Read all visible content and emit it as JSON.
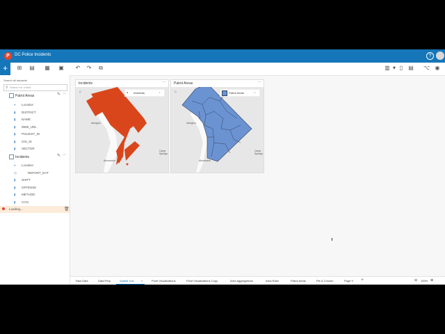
{
  "app": {
    "title": "DC Police Incidents",
    "logo_letter": "P"
  },
  "sidebar": {
    "search_placeholder": "Search all datasets",
    "search_small": "Search for a field",
    "datasets": [
      {
        "name": "Patrol Areas",
        "fields": [
          "Location",
          "DISTRICT",
          "NAME",
          "WEB_URL",
          "POLDIST_ID",
          "GIS_ID",
          "SECTOR"
        ]
      },
      {
        "name": "Incidents",
        "fields": [
          "Location",
          "REPORT_DAT",
          "SHIFT",
          "OFFENSE",
          "METHOD",
          "CCN"
        ]
      }
    ],
    "loading_text": "Loading..."
  },
  "cards": [
    {
      "title": "Incidents",
      "legend": "Incidents"
    },
    {
      "title": "Patrol Areas",
      "legend": "Patrol Areas"
    }
  ],
  "map_labels": {
    "arlington": "Arlington",
    "alexandria": "Alexandria",
    "camp_springs": "Camp Springs"
  },
  "tabs": [
    "Raw Data",
    "Data Prep",
    "Spatial Join",
    "Point Visualizations",
    "Point Visualizations Copy",
    "Area Aggregations",
    "Area Ratio",
    "Patrol Areas",
    "Pie & Column",
    "Page 9"
  ],
  "active_tab": "Spatial Join",
  "zoom": "100%"
}
